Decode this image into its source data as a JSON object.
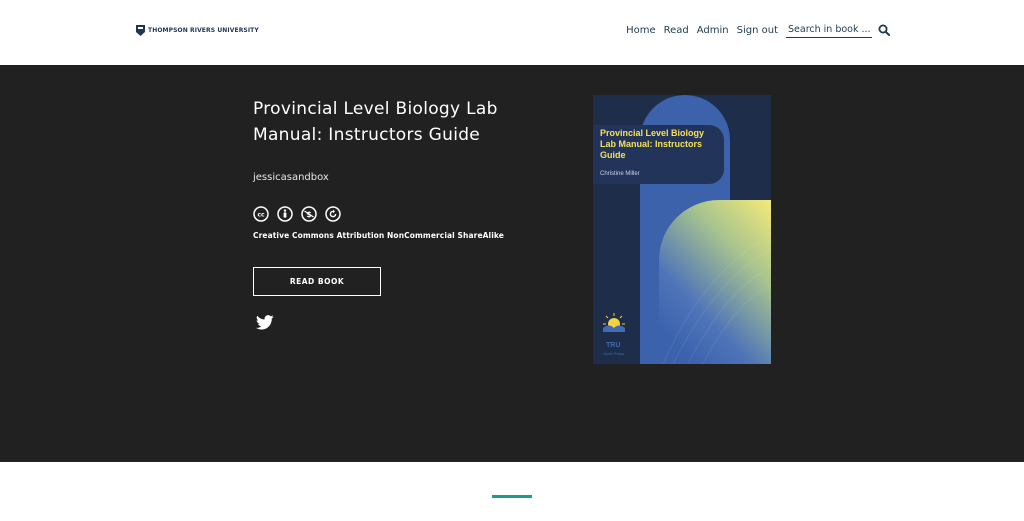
{
  "header": {
    "logo_text": "THOMPSON RIVERS UNIVERSITY",
    "nav": [
      "Home",
      "Read",
      "Admin",
      "Sign out"
    ],
    "search_placeholder": "Search in book ..."
  },
  "book": {
    "title": "Provincial Level Biology Lab Manual: Instructors Guide",
    "author": "jessicasandbox",
    "license": "Creative Commons Attribution NonCommercial ShareAlike",
    "read_button": "READ BOOK"
  },
  "cover": {
    "title": "Provincial Level Biology Lab Manual: Instructors Guide",
    "author": "Christine Miller",
    "publisher_line1": "TRU",
    "publisher_line2": "Open Press"
  },
  "colors": {
    "hero_bg": "#212121",
    "nav_text": "#1d3c4f",
    "accent": "#1a9e8c",
    "cover_title": "#f5e05a"
  }
}
